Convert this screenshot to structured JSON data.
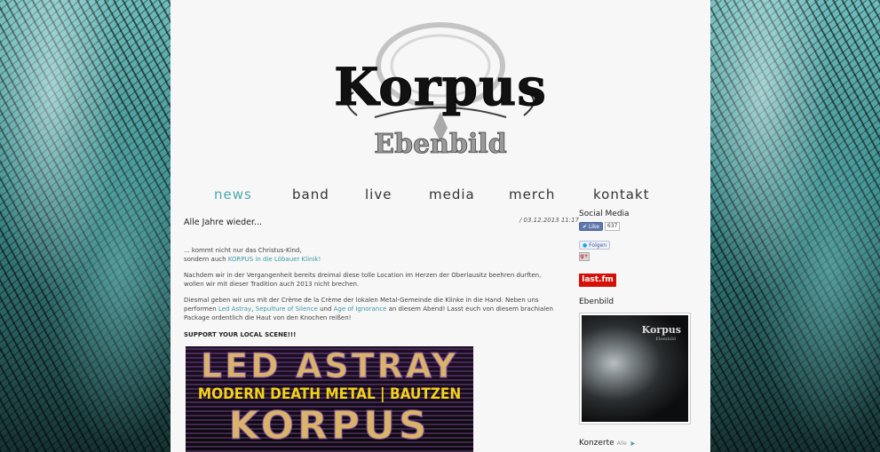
{
  "logo": {
    "band_name": "Korpus",
    "subtitle": "Ebenbild"
  },
  "nav": {
    "items": [
      {
        "label": "News",
        "active": true
      },
      {
        "label": "Band",
        "active": false
      },
      {
        "label": "Live",
        "active": false
      },
      {
        "label": "Media",
        "active": false
      },
      {
        "label": "Merch",
        "active": false
      },
      {
        "label": "Kontakt",
        "active": false
      }
    ]
  },
  "post": {
    "title": "Alle Jahre wieder...",
    "date": "/ 03.12.2013 11:17",
    "intro_line1": "... kommt nicht nur das Christus-Kind,",
    "intro_line2_prefix": "sondern auch ",
    "intro_line2_link": "KORPUS in die Löbauer Klinik!",
    "para1": "Nachdem wir in der Vergangenheit bereits dreimal diese tolle Location im Herzen der Oberlausitz beehren durften, wollen wir mit dieser Tradition auch 2013 nicht brechen.",
    "para2_a": "Diesmal geben wir uns mit der Crème de la Crème der lokalen Metal-Gemeinde die Klinke in die Hand: Neben uns performen ",
    "para2_link1": "Led Astray",
    "para2_sep1": ", ",
    "para2_link2": "Sepulture of Silence",
    "para2_sep2": " und ",
    "para2_link3": "Age of Ignorance",
    "para2_b": " an diesem Abend! Lasst euch von diesem brachialen Package ordentlich die Haut von den Knochen reißen!",
    "support": "SUPPORT YOUR LOCAL SCENE!!!",
    "poster_line1": "LED ASTRAY",
    "poster_line2": "MODERN DEATH METAL | BAUTZEN",
    "poster_line3": "KORPUS"
  },
  "sidebar": {
    "social_heading": "Social Media",
    "fb_like_label": "Like",
    "fb_like_count": "637",
    "twitter_label": "Folgen",
    "gplus_label": "g+",
    "lastfm_label": "last.fm",
    "ebenbild_heading": "Ebenbild",
    "album_title": "Korpus",
    "album_subtitle": "Ebenbild",
    "konzerte_heading": "Konzerte",
    "konzerte_link": "Alle"
  }
}
